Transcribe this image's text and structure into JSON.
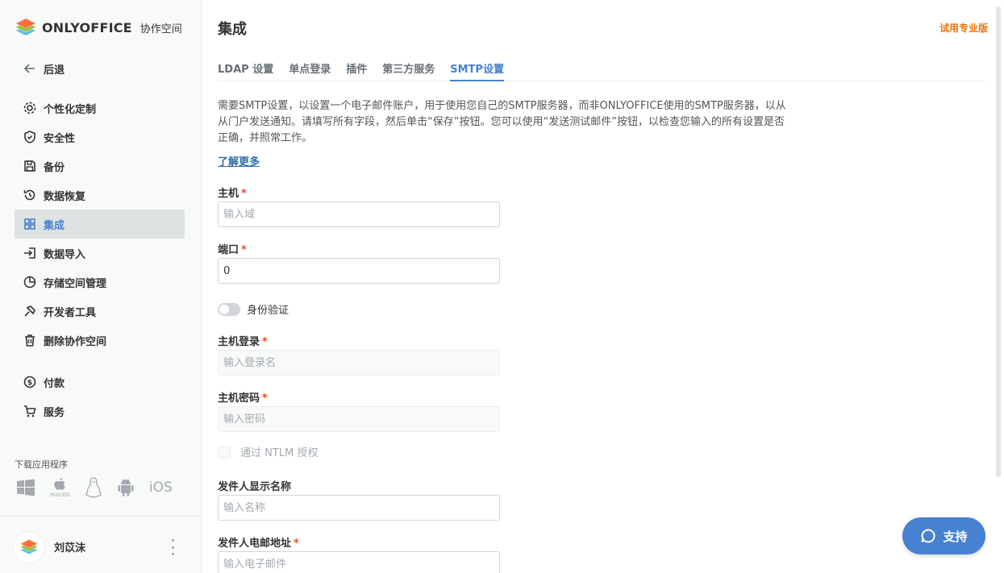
{
  "app": {
    "logo_text": "ONLYOFFICE",
    "logo_sub": "协作空间"
  },
  "sidebar": {
    "back_label": "后退",
    "items": [
      {
        "label": "个性化定制",
        "icon": "gear-icon"
      },
      {
        "label": "安全性",
        "icon": "shield-icon"
      },
      {
        "label": "备份",
        "icon": "floppy-icon"
      },
      {
        "label": "数据恢复",
        "icon": "history-icon"
      },
      {
        "label": "集成",
        "icon": "grid-icon",
        "active": true
      },
      {
        "label": "数据导入",
        "icon": "import-icon"
      },
      {
        "label": "存储空间管理",
        "icon": "pie-chart-icon"
      },
      {
        "label": "开发者工具",
        "icon": "developer-icon"
      },
      {
        "label": "删除协作空间",
        "icon": "trash-icon"
      }
    ],
    "items2": [
      {
        "label": "付款",
        "icon": "dollar-icon"
      },
      {
        "label": "服务",
        "icon": "cart-icon"
      }
    ],
    "download_label": "下载应用程序",
    "apps": {
      "macos": "macOS",
      "ios": "iOS"
    },
    "user": {
      "name": "刘苡沫"
    }
  },
  "header": {
    "title": "集成",
    "trial_link": "试用专业版"
  },
  "tabs": [
    {
      "label": "LDAP 设置"
    },
    {
      "label": "单点登录"
    },
    {
      "label": "插件"
    },
    {
      "label": "第三方服务"
    },
    {
      "label": "SMTP设置",
      "active": true
    }
  ],
  "content": {
    "description": "需要SMTP设置，以设置一个电子邮件账户，用于使用您自己的SMTP服务器，而非ONLYOFFICE使用的SMTP服务器，以从从门户发送通知。请填写所有字段，然后单击“保存”按钮。您可以使用“发送测试邮件”按钮，以检查您输入的所有设置是否正确，并照常工作。",
    "learn_more": "了解更多",
    "host": {
      "label": "主机",
      "placeholder": "输入域",
      "value": ""
    },
    "port": {
      "label": "端口",
      "value": "0"
    },
    "auth_toggle": {
      "label": "身份验证",
      "on": false
    },
    "host_login": {
      "label": "主机登录",
      "placeholder": "输入登录名"
    },
    "host_password": {
      "label": "主机密码",
      "placeholder": "输入密码"
    },
    "ntlm": {
      "label": "通过 NTLM 授权"
    },
    "sender_name": {
      "label": "发件人显示名称",
      "placeholder": "输入名称"
    },
    "sender_email": {
      "label": "发件人电邮地址",
      "placeholder": "输入电子邮件"
    },
    "required_mark": "*"
  },
  "support": {
    "label": "支持"
  },
  "colors": {
    "accent": "#4781d1",
    "trial": "#ed7309",
    "required": "#f24724"
  }
}
